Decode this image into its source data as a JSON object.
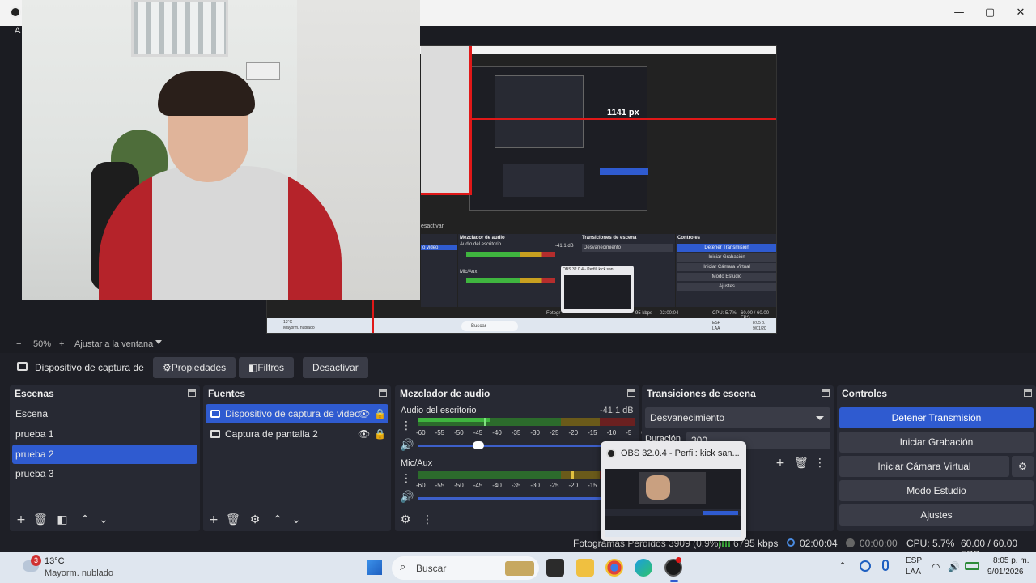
{
  "titlebar": {
    "left_label": "A",
    "minimize": "—",
    "maximize": "▢",
    "close": "✕"
  },
  "preview": {
    "nested_px_label": "1141 px",
    "nested_deactivate": "esactivar",
    "nested_mixer": "Mezclador de audio",
    "nested_transitions": "Transiciones de escena",
    "nested_controls": "Controles",
    "nested_stop": "Detener Transmisión",
    "nested_start_rec": "Iniciar Grabación",
    "nested_virtual_cam": "Iniciar Cámara Virtual",
    "nested_studio": "Modo Estudio",
    "nested_settings": "Ajustes",
    "nested_fade": "Desvanecimiento",
    "nested_desktop_audio": "Audio del escritorio",
    "nested_db": "-41.1 dB",
    "nested_mic": "Mic/Aux",
    "nested_video": "o video",
    "nested_popup": "OBS 32.0.4 - Perfil: kick san...",
    "nested_cpu": "CPU: 5.7%",
    "nested_fps": "60.00 / 60.00 FPS",
    "nested_time": "02:00:04",
    "nested_kbps": "95 kbps",
    "nested_frames": "Fotogr",
    "nested_search": "Buscar",
    "nested_weather": "13°C",
    "nested_weather2": "Mayorm. nublado",
    "nested_lang": "ESP",
    "nested_lang2": "LAA",
    "nested_clock": "8:05 p.",
    "nested_date": "9/01/20"
  },
  "zoom": {
    "minus": "−",
    "percent": "50%",
    "plus": "+",
    "fit": "Ajustar a la ventana"
  },
  "source_toolbar": {
    "source_name": "Dispositivo de captura de v",
    "properties": "Propiedades",
    "filters": "Filtros",
    "deactivate": "Desactivar"
  },
  "scenes": {
    "title": "Escenas",
    "items": [
      {
        "label": "Escena",
        "selected": false
      },
      {
        "label": "prueba 1",
        "selected": false
      },
      {
        "label": "prueba 2",
        "selected": true
      },
      {
        "label": "prueba 3",
        "selected": false
      }
    ]
  },
  "sources": {
    "title": "Fuentes",
    "items": [
      {
        "label": "Dispositivo de captura de video",
        "icon": "camera-icon",
        "selected": true
      },
      {
        "label": "Captura de pantalla 2",
        "icon": "monitor-icon",
        "selected": false
      }
    ]
  },
  "mixer": {
    "title": "Mezclador de audio",
    "channels": [
      {
        "name": "Audio del escritorio",
        "db": "-41.1 dB"
      },
      {
        "name": "Mic/Aux",
        "db": ""
      }
    ],
    "scale": [
      "-60",
      "-55",
      "-50",
      "-45",
      "-40",
      "-35",
      "-30",
      "-25",
      "-20",
      "-15",
      "-10",
      "-5",
      "0"
    ]
  },
  "transitions": {
    "title": "Transiciones de escena",
    "selected": "Desvanecimiento",
    "duration_label": "Duración",
    "duration_value": "300"
  },
  "controls": {
    "title": "Controles",
    "stop_stream": "Detener Transmisión",
    "start_recording": "Iniciar Grabación",
    "start_virtual_cam": "Iniciar Cámara Virtual",
    "studio_mode": "Modo Estudio",
    "settings": "Ajustes"
  },
  "statusbar": {
    "frames": "Fotogramas Perdidos 3909 (0.9%)",
    "kbps": "6795 kbps",
    "stream_time": "02:00:04",
    "rec_time": "00:00:00",
    "cpu": "CPU: 5.7%",
    "fps": "60.00 / 60.00 FPS"
  },
  "popup": {
    "title": "OBS 32.0.4 - Perfil: kick san..."
  },
  "taskbar": {
    "weather_badge": "3",
    "temperature": "13°C",
    "weather": "Mayorm. nublado",
    "search": "Buscar",
    "lang1": "ESP",
    "lang2": "LAA",
    "time": "8:05 p. m.",
    "date": "9/01/2026"
  },
  "colors": {
    "accent": "#2f5bd0",
    "record_red": "#e01818",
    "meter_green": "#3fb53f",
    "meter_yellow": "#c8a020",
    "meter_red": "#b52d2d"
  }
}
